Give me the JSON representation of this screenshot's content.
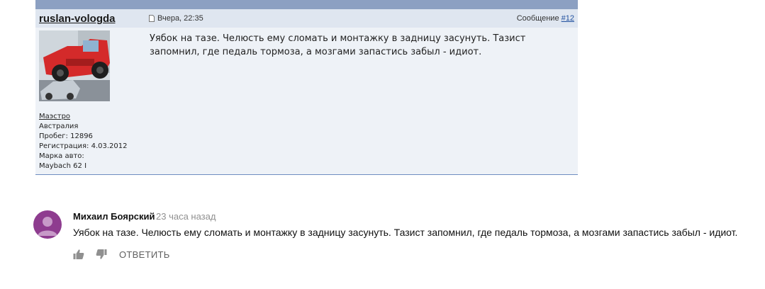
{
  "post": {
    "author": "ruslan-vologda",
    "date": "Вчера, 22:35",
    "message_label": "Сообщение",
    "message_number": "#12",
    "text": "Уябок на тазе. Челюсть ему сломать и монтажку в задницу засунуть. Тазист запомнил, где педаль тормоза, а мозгами запастись забыл - идиот.",
    "user": {
      "rank": "Маэстро",
      "location": "Австралия",
      "mileage": "Пробег: 12896",
      "registration": "Регистрация: 4.03.2012",
      "car_label": "Марка авто:",
      "car": "Maybach 62 I"
    }
  },
  "comment": {
    "author": "Михаил Боярский",
    "time": "23 часа назад",
    "text": "Уябок на тазе. Челюсть ему сломать и монтажку в задницу засунуть. Тазист запомнил, где педаль тормоза, а мозгами запастись забыл - идиот.",
    "reply_label": "ОТВЕТИТЬ",
    "like_icon": "thumb-up-icon",
    "dislike_icon": "thumb-down-icon"
  },
  "colors": {
    "post_header_bg": "#dfe6f0",
    "post_body_bg": "#eef2f7",
    "post_topbar": "#8ca0c2",
    "comment_avatar": "#8e3c8f"
  }
}
